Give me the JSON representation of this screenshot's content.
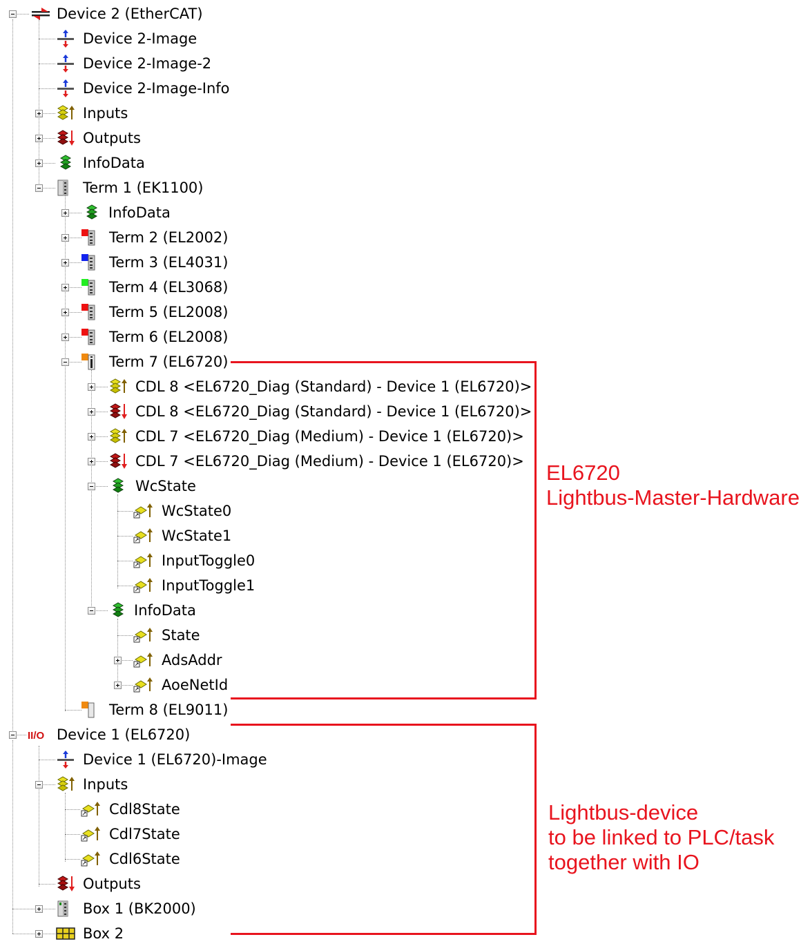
{
  "tree": {
    "nodes": [
      {
        "label": "Device 2 (EtherCAT)",
        "icon": "ethercat-device-icon",
        "expanded": true
      },
      {
        "label": "Device 2-Image",
        "icon": "process-image-icon"
      },
      {
        "label": "Device 2-Image-2",
        "icon": "process-image-icon"
      },
      {
        "label": "Device 2-Image-Info",
        "icon": "process-image-icon"
      },
      {
        "label": "Inputs",
        "icon": "inputs-icon",
        "expanded": false
      },
      {
        "label": "Outputs",
        "icon": "outputs-icon",
        "expanded": false
      },
      {
        "label": "InfoData",
        "icon": "infodata-icon",
        "expanded": false
      },
      {
        "label": "Term 1 (EK1100)",
        "icon": "coupler-icon",
        "expanded": true
      },
      {
        "label": "InfoData",
        "icon": "infodata-icon",
        "expanded": false
      },
      {
        "label": "Term 2 (EL2002)",
        "icon": "terminal-red-icon",
        "expanded": false
      },
      {
        "label": "Term 3 (EL4031)",
        "icon": "terminal-blue-icon",
        "expanded": false
      },
      {
        "label": "Term 4 (EL3068)",
        "icon": "terminal-green-icon",
        "expanded": false
      },
      {
        "label": "Term 5 (EL2008)",
        "icon": "terminal-red-icon",
        "expanded": false
      },
      {
        "label": "Term 6 (EL2008)",
        "icon": "terminal-red-icon",
        "expanded": false
      },
      {
        "label": "Term 7 (EL6720)",
        "icon": "terminal-orange-icon",
        "expanded": true
      },
      {
        "label": "CDL 8 <EL6720_Diag (Standard) - Device 1 (EL6720)>",
        "icon": "inputs-icon",
        "expanded": false
      },
      {
        "label": "CDL 8 <EL6720_Diag (Standard) - Device 1 (EL6720)>",
        "icon": "outputs-icon",
        "expanded": false
      },
      {
        "label": "CDL 7 <EL6720_Diag (Medium) - Device 1 (EL6720)>",
        "icon": "inputs-icon",
        "expanded": false
      },
      {
        "label": "CDL 7 <EL6720_Diag (Medium) - Device 1 (EL6720)>",
        "icon": "outputs-icon",
        "expanded": false
      },
      {
        "label": "WcState",
        "icon": "infodata-icon",
        "expanded": true
      },
      {
        "label": "WcState0",
        "icon": "input-variable-icon"
      },
      {
        "label": "WcState1",
        "icon": "input-variable-icon"
      },
      {
        "label": "InputToggle0",
        "icon": "input-variable-icon"
      },
      {
        "label": "InputToggle1",
        "icon": "input-variable-icon"
      },
      {
        "label": "InfoData",
        "icon": "infodata-icon",
        "expanded": true
      },
      {
        "label": "State",
        "icon": "input-variable-icon"
      },
      {
        "label": "AdsAddr",
        "icon": "input-variable-icon",
        "expanded": false
      },
      {
        "label": "AoeNetId",
        "icon": "input-variable-icon",
        "expanded": false
      },
      {
        "label": "Term 8 (EL9011)",
        "icon": "end-terminal-icon"
      },
      {
        "label": "Device 1 (EL6720)",
        "icon": "io-device-icon",
        "expanded": true
      },
      {
        "label": "Device 1 (EL6720)-Image",
        "icon": "process-image-icon"
      },
      {
        "label": "Inputs",
        "icon": "inputs-icon",
        "expanded": true
      },
      {
        "label": "Cdl8State",
        "icon": "input-variable-icon"
      },
      {
        "label": "Cdl7State",
        "icon": "input-variable-icon"
      },
      {
        "label": "Cdl6State",
        "icon": "input-variable-icon"
      },
      {
        "label": "Outputs",
        "icon": "outputs-icon"
      },
      {
        "label": "Box 1 (BK2000)",
        "icon": "bus-coupler-icon",
        "expanded": false
      },
      {
        "label": "Box 2",
        "icon": "box-icon",
        "expanded": false
      }
    ]
  },
  "annotations": {
    "ann1": {
      "line1": "EL6720",
      "line2": "Lightbus-Master-Hardware"
    },
    "ann2": {
      "line1": "Lightbus-device",
      "line2": "to be linked to PLC/task",
      "line3": "together with IO"
    }
  },
  "colors": {
    "annotation": "#e8141e",
    "tree_lines": "#8a8a8a"
  }
}
